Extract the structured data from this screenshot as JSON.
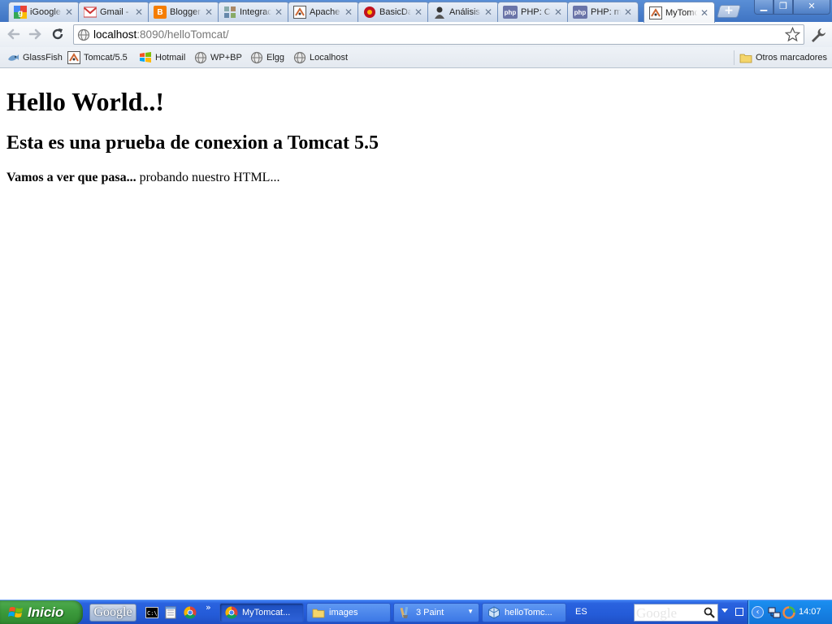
{
  "window": {
    "tabs": [
      {
        "label": "iGoogle",
        "icon": "igoogle-icon"
      },
      {
        "label": "Gmail - F",
        "icon": "gmail-icon"
      },
      {
        "label": "Blogger:",
        "icon": "blogger-icon"
      },
      {
        "label": "Integrac",
        "icon": "integration-icon"
      },
      {
        "label": "Apache",
        "icon": "apache-icon"
      },
      {
        "label": "BasicDat",
        "icon": "basicdata-icon"
      },
      {
        "label": "Análisis",
        "icon": "analisis-icon"
      },
      {
        "label": "PHP: Co",
        "icon": "php-icon"
      },
      {
        "label": "PHP: my",
        "icon": "php-icon"
      },
      {
        "label": "MyTomc",
        "icon": "tomcat-icon",
        "active": true
      }
    ],
    "new_tab_label": "+",
    "controls": {
      "minimize": "▁",
      "maximize": "❐",
      "close": "✕"
    }
  },
  "toolbar": {
    "url_host": "localhost",
    "url_rest": ":8090/helloTomcat/"
  },
  "bookmarks": {
    "items": [
      {
        "label": "GlassFish",
        "icon": "glassfish-icon"
      },
      {
        "label": "Tomcat/5.5",
        "icon": "tomcat-icon"
      },
      {
        "label": "Hotmail",
        "icon": "hotmail-icon"
      },
      {
        "label": "WP+BP",
        "icon": "globe-icon"
      },
      {
        "label": "Elgg",
        "icon": "globe-icon"
      },
      {
        "label": "Localhost",
        "icon": "globe-icon"
      }
    ],
    "other": "Otros marcadores"
  },
  "page": {
    "h1": "Hello World..!",
    "h2": "Esta es una prueba de conexion a Tomcat 5.5",
    "p_bold": "Vamos a ver que pasa...",
    "p_rest": " probando nuestro HTML..."
  },
  "taskbar": {
    "start_label": "Inicio",
    "google_label": "Google",
    "more_label": "»",
    "tasks": [
      {
        "label": "MyTomcat...",
        "icon": "chrome-icon",
        "active": true
      },
      {
        "label": "images",
        "icon": "folder-icon",
        "active": false
      },
      {
        "label": "3 Paint",
        "icon": "paint-icon",
        "active": false,
        "grouped": true
      },
      {
        "label": "helloTomc...",
        "icon": "netbeans-icon",
        "active": false
      }
    ],
    "language": "ES",
    "search_watermark": "Google",
    "clock": "14:07"
  },
  "colors": {
    "tab_bar": "#3f74c3",
    "taskbar": "#245bd8",
    "start": "#3c9a3c",
    "tray": "#1273d6"
  }
}
